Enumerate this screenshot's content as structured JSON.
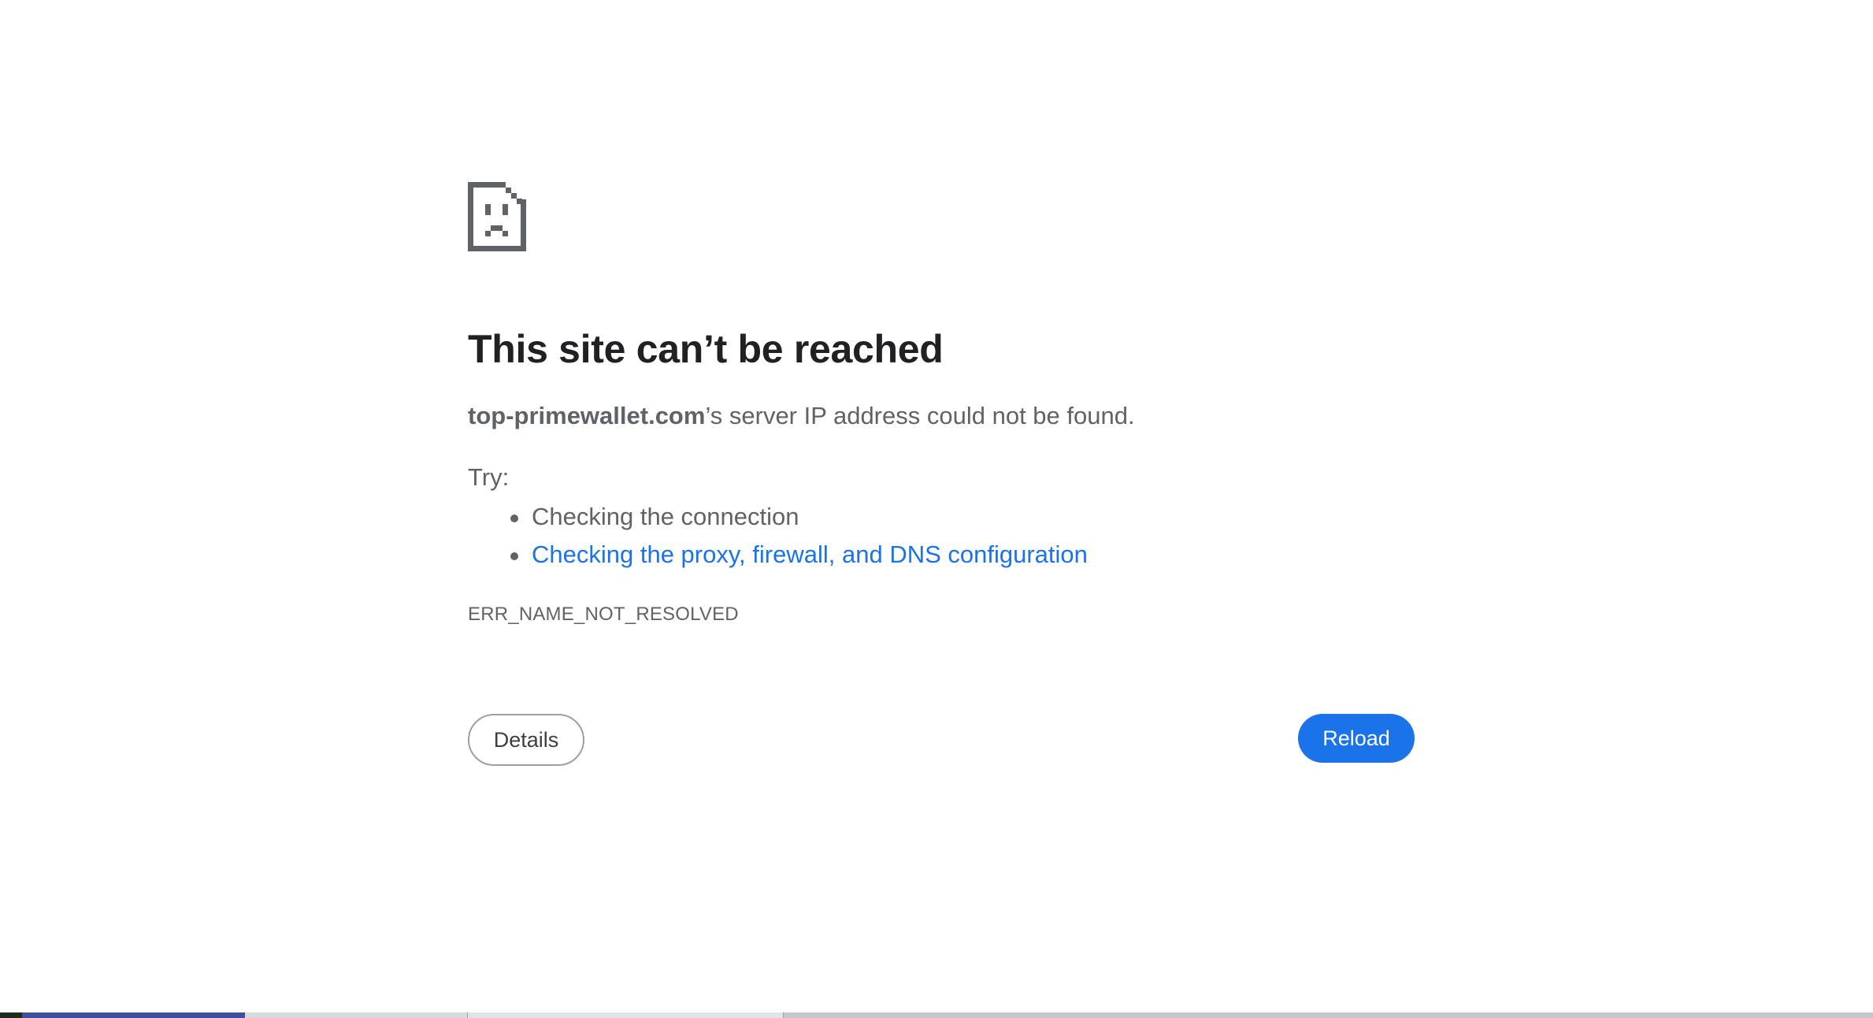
{
  "error_page": {
    "icon": "sad-document-icon",
    "title": "This site can’t be reached",
    "host": "top-primewallet.com",
    "message_suffix": "’s server IP address could not be found.",
    "try_label": "Try:",
    "suggestions": [
      "Checking the connection",
      "Checking the proxy, firewall, and DNS configuration"
    ],
    "error_code": "ERR_NAME_NOT_RESOLVED",
    "details_label": "Details",
    "reload_label": "Reload"
  },
  "colors": {
    "title": "#202124",
    "body_text": "#5f6368",
    "link": "#1a73e8",
    "reload_button": "#1a73e8",
    "details_border": "#9aa0a6",
    "icon": "#5f6368"
  }
}
